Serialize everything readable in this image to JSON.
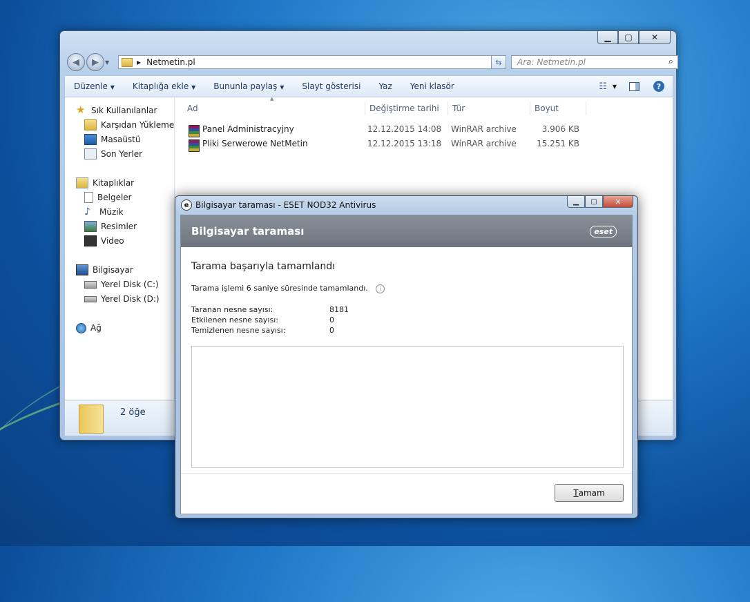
{
  "explorer": {
    "address": "Netmetin.pl",
    "search_placeholder": "Ara: Netmetin.pl",
    "toolbar": [
      "Düzenle",
      "Kitaplığa ekle",
      "Bununla paylaş",
      "Slayt gösterisi",
      "Yaz",
      "Yeni klasör"
    ],
    "nav": {
      "favorites_label": "Sık Kullanılanlar",
      "favorites": [
        "Karşıdan Yüklemeler",
        "Masaüstü",
        "Son Yerler"
      ],
      "libraries_label": "Kitaplıklar",
      "libraries": [
        "Belgeler",
        "Müzik",
        "Resimler",
        "Video"
      ],
      "computer_label": "Bilgisayar",
      "drives": [
        "Yerel Disk (C:)",
        "Yerel Disk (D:)"
      ],
      "network_label": "Ağ"
    },
    "columns": [
      "Ad",
      "Değiştirme tarihi",
      "Tür",
      "Boyut"
    ],
    "files": [
      {
        "name": "Panel Administracyjny",
        "modified": "12.12.2015 14:08",
        "type": "WinRAR archive",
        "size": "3.906 KB"
      },
      {
        "name": "Pliki Serwerowe NetMetin",
        "modified": "12.12.2015 13:18",
        "type": "WinRAR archive",
        "size": "15.251 KB"
      }
    ],
    "item_count": "2 öğe"
  },
  "dialog": {
    "title": "Bilgisayar taraması - ESET NOD32 Antivirus",
    "header": "Bilgisayar taraması",
    "brand": "eset",
    "result_heading": "Tarama başarıyla tamamlandı",
    "duration_text": "Tarama işlemi 6 saniye süresinde tamamlandı.",
    "stats": [
      {
        "label": "Taranan nesne sayısı:",
        "value": "8181"
      },
      {
        "label": "Etkilenen nesne sayısı:",
        "value": "0"
      },
      {
        "label": "Temizlenen nesne sayısı:",
        "value": "0"
      }
    ],
    "ok_hotkey": "T",
    "ok_rest": "amam"
  },
  "colors": {
    "accent": "#1e395b",
    "dialog_header": "#7a8089"
  }
}
